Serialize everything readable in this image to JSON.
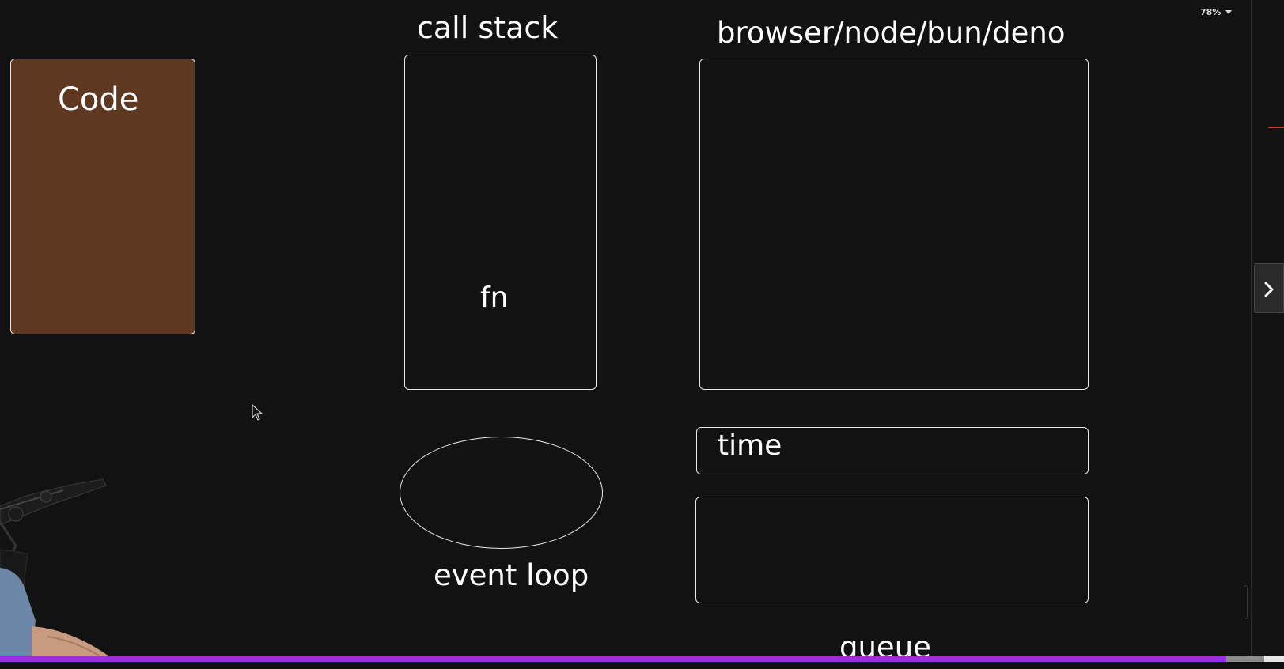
{
  "canvas": {
    "background": "#121212",
    "stroke_color": "#e8e8e8"
  },
  "code_block": {
    "label": "Code",
    "fill_color": "#5f3822"
  },
  "call_stack": {
    "title": "call stack",
    "item": "fn"
  },
  "runtime": {
    "title": "browser/node/bun/deno"
  },
  "timer": {
    "label": "time"
  },
  "queue": {
    "label": "queue"
  },
  "event_loop": {
    "label": "event loop"
  },
  "toolbar": {
    "zoom_value": "78%"
  },
  "side_panel": {
    "toggle_icon": "chevron-right-icon"
  },
  "player": {
    "progress_fraction": 0.955,
    "played_color": "#9b2ee0",
    "track_color": "#6a6a6a"
  },
  "overlay": {
    "webcam": "presenter-webcam",
    "cursor_icon": "mouse-pointer-icon"
  }
}
